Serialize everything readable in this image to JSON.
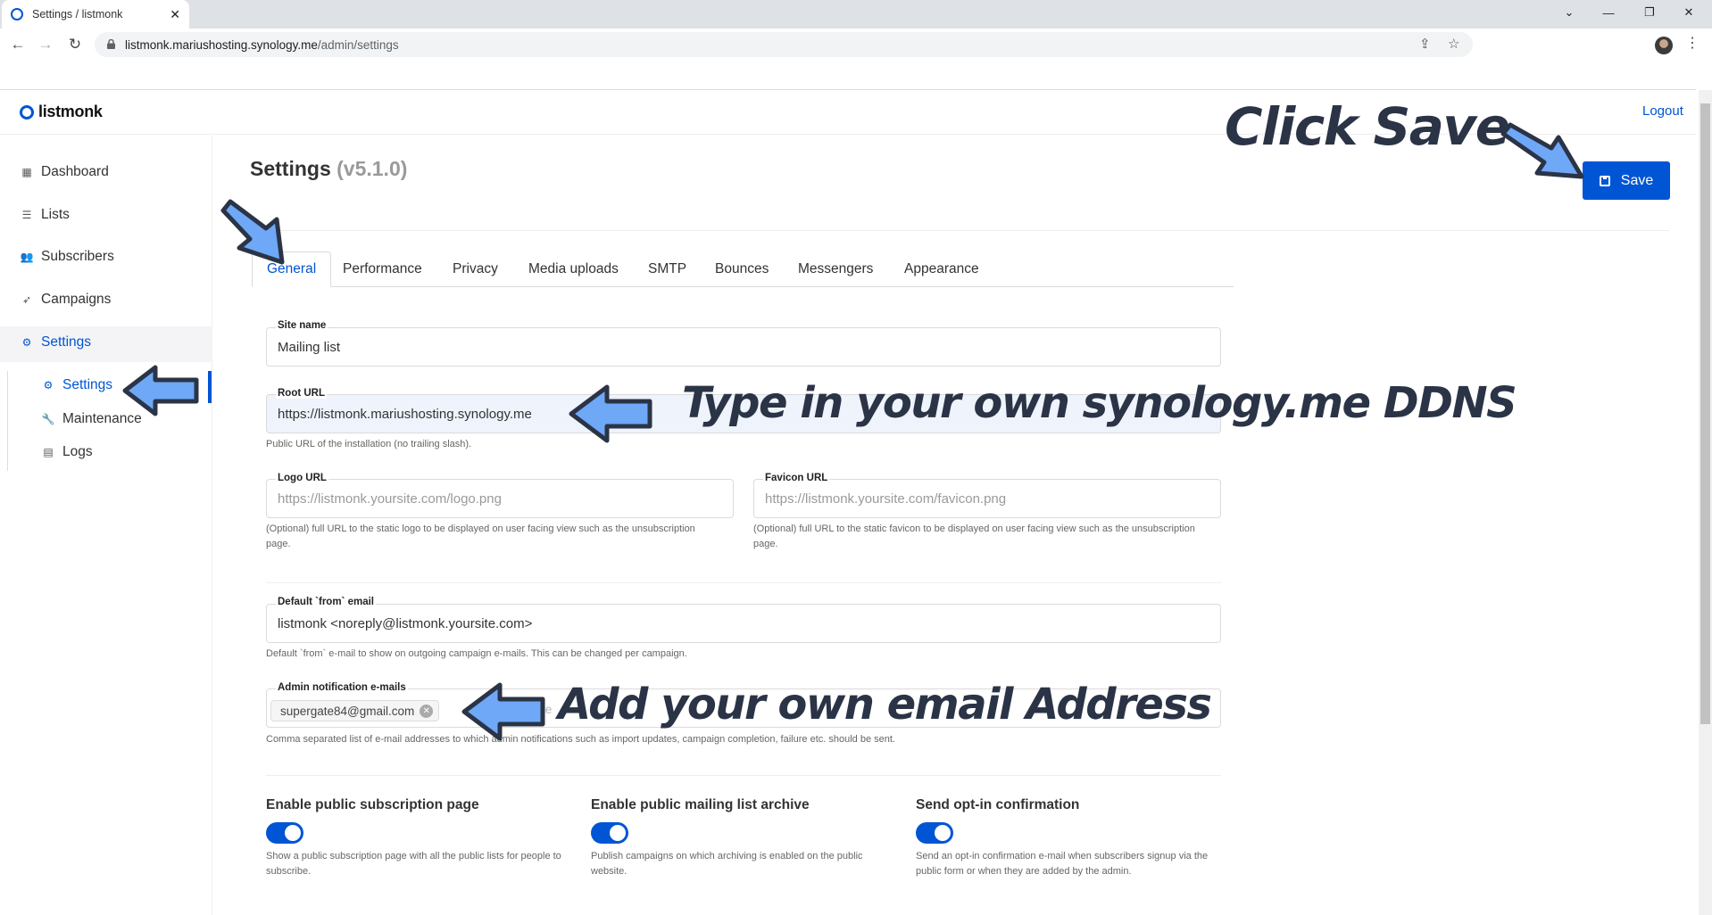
{
  "browser": {
    "tab_title": "Settings / listmonk",
    "url_host": "listmonk.mariushosting.synology.me",
    "url_path": "/admin/settings"
  },
  "app": {
    "logo_text": "listmonk",
    "logout_label": "Logout"
  },
  "sidebar": {
    "items": [
      {
        "label": "Dashboard",
        "icon": "dashboard-icon"
      },
      {
        "label": "Lists",
        "icon": "list-icon"
      },
      {
        "label": "Subscribers",
        "icon": "users-icon"
      },
      {
        "label": "Campaigns",
        "icon": "rocket-icon"
      },
      {
        "label": "Settings",
        "icon": "gear-icon"
      }
    ],
    "sub_items": [
      {
        "label": "Settings",
        "icon": "gear-icon"
      },
      {
        "label": "Maintenance",
        "icon": "wrench-icon"
      },
      {
        "label": "Logs",
        "icon": "logs-icon"
      }
    ]
  },
  "page": {
    "title": "Settings",
    "version": "(v5.1.0)",
    "save_label": "Save"
  },
  "tabs": [
    "General",
    "Performance",
    "Privacy",
    "Media uploads",
    "SMTP",
    "Bounces",
    "Messengers",
    "Appearance"
  ],
  "active_tab": "General",
  "form": {
    "site_name_label": "Site name",
    "site_name_value": "Mailing list",
    "root_url_label": "Root URL",
    "root_url_value": "https://listmonk.mariushosting.synology.me",
    "root_url_help": "Public URL of the installation (no trailing slash).",
    "logo_url_label": "Logo URL",
    "logo_url_placeholder": "https://listmonk.yoursite.com/logo.png",
    "logo_url_help": "(Optional) full URL to the static logo to be displayed on user facing view such as the unsubscription page.",
    "favicon_url_label": "Favicon URL",
    "favicon_url_placeholder": "https://listmonk.yoursite.com/favicon.png",
    "favicon_url_help": "(Optional) full URL to the static favicon to be displayed on user facing view such as the unsubscription page.",
    "from_email_label": "Default `from` email",
    "from_email_value": "listmonk <noreply@listmonk.yoursite.com>",
    "from_email_help": "Default `from` e-mail to show on outgoing campaign e-mails. This can be changed per campaign.",
    "admin_emails_label": "Admin notification e-mails",
    "admin_emails_tag": "supergate84@gmail.com",
    "admin_emails_placeholder": "te",
    "admin_emails_help": "Comma separated list of e-mail addresses to which admin notifications such as import updates, campaign completion, failure etc. should be sent.",
    "toggles": [
      {
        "title": "Enable public subscription page",
        "enabled": true,
        "help": "Show a public subscription page with all the public lists for people to subscribe."
      },
      {
        "title": "Enable public mailing list archive",
        "enabled": true,
        "help": "Publish campaigns on which archiving is enabled on the public website."
      },
      {
        "title": "Send opt-in confirmation",
        "enabled": true,
        "help": "Send an opt-in confirmation e-mail when subscribers signup via the public form or when they are added by the admin."
      }
    ]
  },
  "annotations": {
    "click_save": "Click Save",
    "type_ddns": "Type in your own synology.me DDNS",
    "add_email": "Add your own email Address",
    "arrow_color": "#6ea8f7"
  },
  "colors": {
    "accent": "#0055d4",
    "annotation_text": "#2b3446"
  }
}
